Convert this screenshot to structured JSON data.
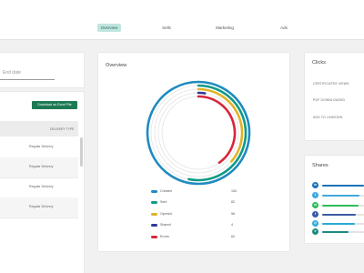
{
  "nav": {
    "tabs": [
      {
        "label": "Overview",
        "active": true
      },
      {
        "label": "Sells",
        "active": false
      },
      {
        "label": "Marketing",
        "active": false
      },
      {
        "label": "Ads",
        "active": false
      }
    ]
  },
  "filters": {
    "end_date_placeholder": "End date"
  },
  "table": {
    "export_label": "Download as Excel File",
    "column_header": "DELIVERY TYPE",
    "rows": [
      "Regular Delivery",
      "Regular Delivery",
      "Regular Delivery",
      "Regular Delivery"
    ]
  },
  "overview": {
    "title": "Overview",
    "chart_data": {
      "type": "radial-bar",
      "max": 154,
      "series": [
        {
          "name": "Created",
          "value": 154,
          "color": "#1f8bc0"
        },
        {
          "name": "Sent",
          "value": 82,
          "color": "#0e9b86"
        },
        {
          "name": "Opened",
          "value": 56,
          "color": "#e2b227"
        },
        {
          "name": "Shared",
          "value": 4,
          "color": "#2f3b9a"
        },
        {
          "name": "Errors",
          "value": 62,
          "color": "#d9263b"
        }
      ]
    }
  },
  "clicks": {
    "title": "Clicks",
    "items": [
      "CERTIFICATES VIEWS",
      "PDF DOWNLOADED",
      "ADD TO LINKEDIN"
    ]
  },
  "shares": {
    "title": "Shares",
    "items": [
      {
        "icon": "linkedin-icon",
        "glyph": "in",
        "color": "#1a73b8",
        "level": 1.0
      },
      {
        "icon": "twitter-icon",
        "glyph": "t",
        "color": "#3fa9dd",
        "level": 0.9
      },
      {
        "icon": "whatsapp-icon",
        "glyph": "w",
        "color": "#2ebd59",
        "level": 0.88
      },
      {
        "icon": "facebook-icon",
        "glyph": "f",
        "color": "#3b5aa5",
        "level": 0.8
      },
      {
        "icon": "email-icon",
        "glyph": "@",
        "color": "#2aa9d8",
        "level": 0.78
      },
      {
        "icon": "telegram-icon",
        "glyph": "➤",
        "color": "#1d8a7f",
        "level": 0.62
      }
    ]
  }
}
